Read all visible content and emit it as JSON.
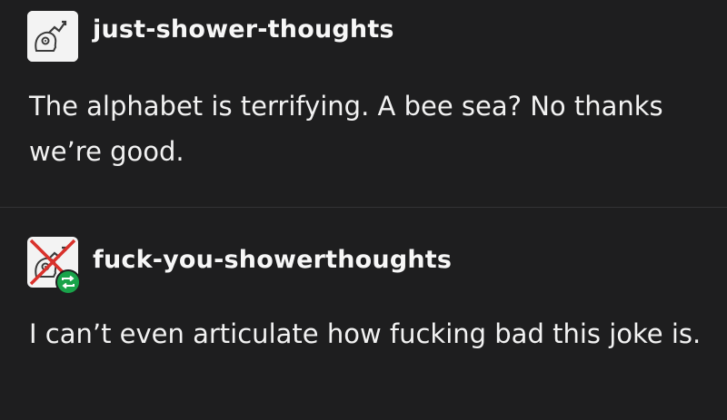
{
  "posts": [
    {
      "username": "just-shower-thoughts",
      "text": "The alphabet is terrifying. A bee sea? No thanks we’re good.",
      "avatar_icon": "brain-chart-icon"
    },
    {
      "username": "fuck-you-showerthoughts",
      "text": "I can’t even articulate how fucking bad this joke is.",
      "avatar_icon": "crossed-brain-chart-icon",
      "badge_icon": "reblog-icon",
      "badge_color": "#19a34a"
    }
  ],
  "colors": {
    "background": "#1e1e1f",
    "text": "#f2f2f2",
    "cross": "#d9312b"
  }
}
